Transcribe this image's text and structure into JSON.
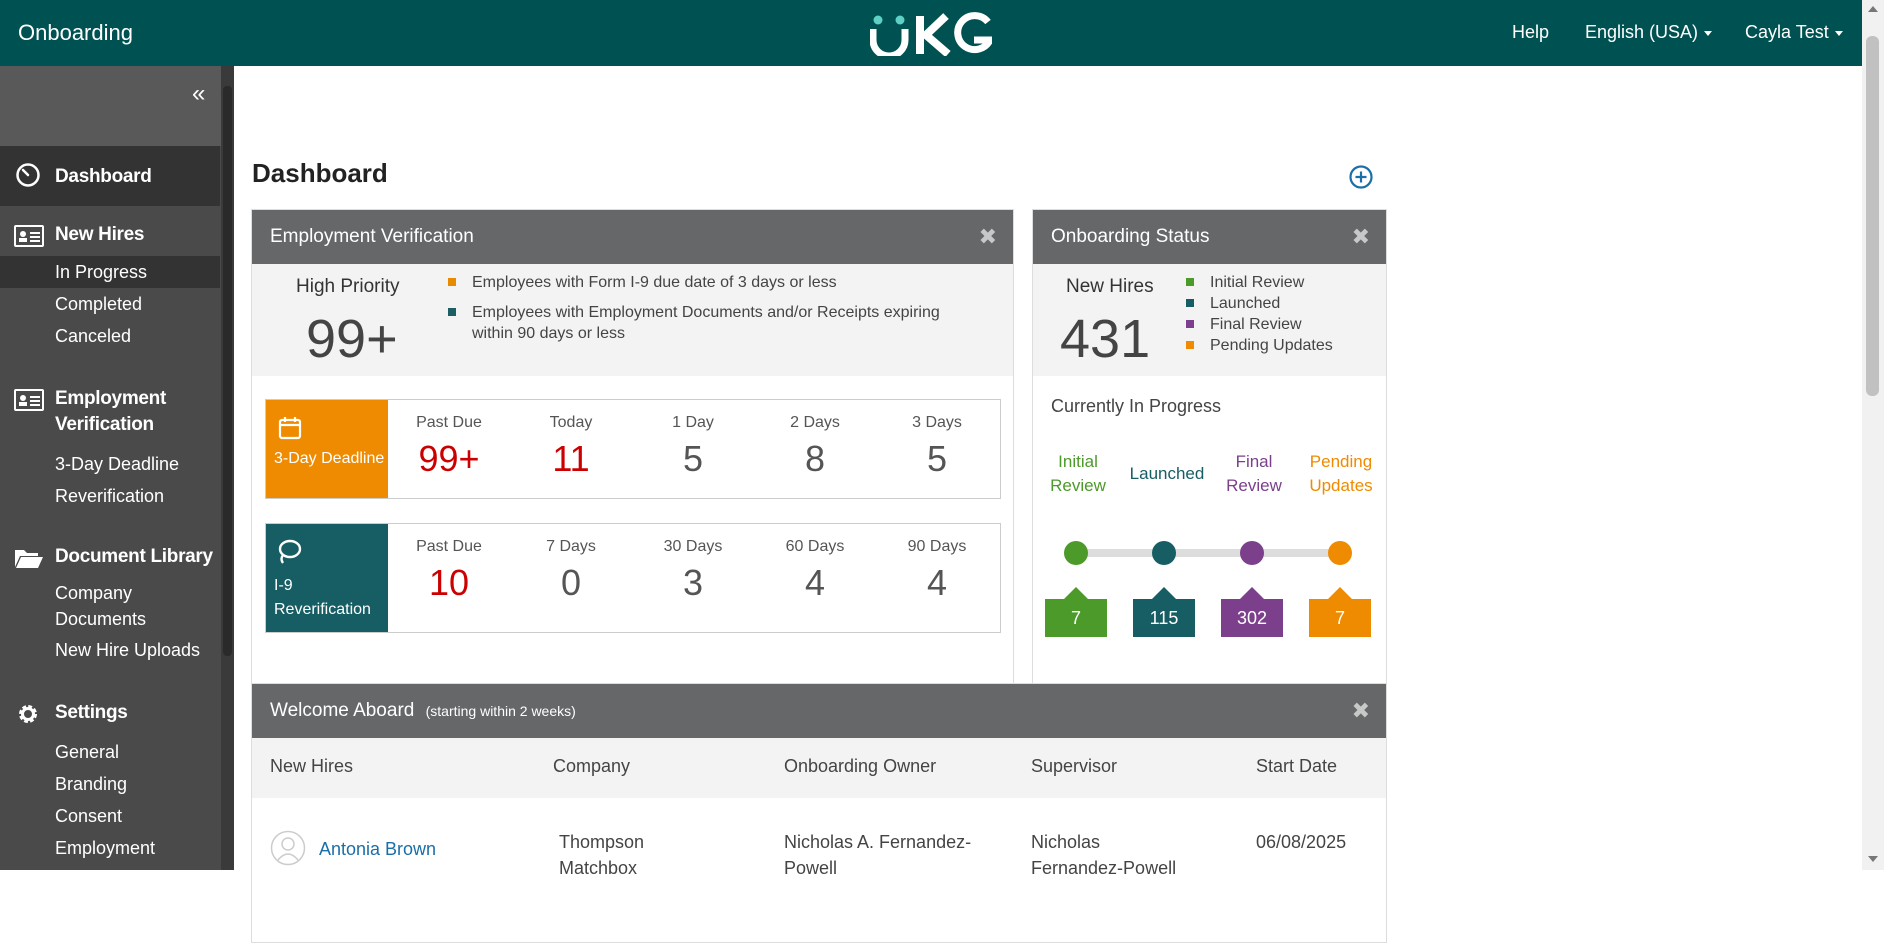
{
  "header": {
    "app_title": "Onboarding",
    "logo_text": "UKG",
    "help": "Help",
    "language": "English (USA)",
    "user": "Cayla Test"
  },
  "sidebar": {
    "collapse_icon": "double-chevron-left-icon",
    "dashboard": "Dashboard",
    "new_hires": {
      "label": "New Hires",
      "items": [
        "In Progress",
        "Completed",
        "Canceled"
      ]
    },
    "employment_verification": {
      "label_line1": "Employment",
      "label_line2": "Verification",
      "items": [
        "3-Day Deadline",
        "Reverification"
      ]
    },
    "document_library": {
      "label": "Document Library",
      "items": [
        "Company Documents",
        "New Hire Uploads"
      ]
    },
    "settings": {
      "label": "Settings",
      "items": [
        "General",
        "Branding",
        "Consent",
        "Employment Eligibility"
      ]
    }
  },
  "page": {
    "title": "Dashboard"
  },
  "employment_verification": {
    "title": "Employment Verification",
    "high_priority_label": "High Priority",
    "high_priority_value": "99+",
    "legend": [
      {
        "text": "Employees with Form I-9 due date of 3 days or less",
        "color": "#e88a00"
      },
      {
        "text": "Employees with Employment Documents and/or Receipts expiring",
        "text2": "within 90 days or less",
        "color": "#1b5e63"
      }
    ],
    "deadline": {
      "label": "3-Day Deadline",
      "color": "#ef8b00",
      "cols": [
        {
          "cap": "Past Due",
          "val": "99+"
        },
        {
          "cap": "Today",
          "val": "11"
        },
        {
          "cap": "1 Day",
          "val": "5"
        },
        {
          "cap": "2 Days",
          "val": "8"
        },
        {
          "cap": "3 Days",
          "val": "5"
        }
      ]
    },
    "reverification": {
      "label1": "I-9",
      "label2": "Reverification",
      "color": "#175e64",
      "cols": [
        {
          "cap": "Past Due",
          "val": "10"
        },
        {
          "cap": "7 Days",
          "val": "0"
        },
        {
          "cap": "30 Days",
          "val": "3"
        },
        {
          "cap": "60 Days",
          "val": "4"
        },
        {
          "cap": "90 Days",
          "val": "4"
        }
      ]
    }
  },
  "onboarding_status": {
    "title": "Onboarding Status",
    "new_hires_label": "New Hires",
    "new_hires_value": "431",
    "legend": [
      "Initial Review",
      "Launched",
      "Final Review",
      "Pending Updates"
    ],
    "in_progress_label": "Currently In Progress",
    "stages": [
      {
        "l1": "Initial",
        "l2": "Review",
        "count": "7",
        "color": "#4c9a2a"
      },
      {
        "l1": "Launched",
        "l2": "",
        "count": "115",
        "color": "#175e64"
      },
      {
        "l1": "Final",
        "l2": "Review",
        "count": "302",
        "color": "#7b3f8c"
      },
      {
        "l1": "Pending",
        "l2": "Updates",
        "count": "7",
        "color": "#ef8b00"
      }
    ]
  },
  "welcome": {
    "title": "Welcome Aboard",
    "subtitle": "(starting within 2 weeks)",
    "columns": [
      "New Hires",
      "Company",
      "Onboarding Owner",
      "Supervisor",
      "Start Date"
    ],
    "rows": [
      {
        "name": "Antonia Brown",
        "company_1": "Thompson",
        "company_2": "Matchbox",
        "owner_1": "Nicholas A. Fernandez-",
        "owner_2": "Powell",
        "supervisor_1": "Nicholas",
        "supervisor_2": "Fernandez-Powell",
        "start": "06/08/2025"
      }
    ]
  },
  "colors": {
    "header": "#005151",
    "sidebar": "#4a4a4a",
    "link": "#1a6fa8",
    "alert_red": "#cc0000"
  }
}
